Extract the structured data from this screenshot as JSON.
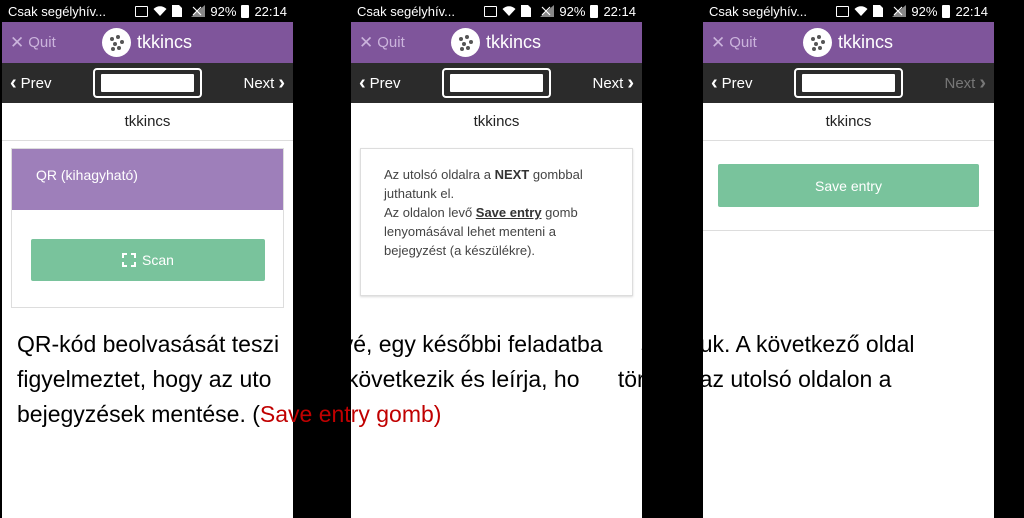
{
  "status_bar": {
    "carrier": "Csak segélyhív...",
    "battery": "92%",
    "time": "22:14"
  },
  "app_bar": {
    "quit_label": "Quit",
    "brand_name": "tkkincs"
  },
  "nav": {
    "prev_label": "Prev",
    "next_label": "Next"
  },
  "page_title": "tkkincs",
  "screen1": {
    "qr_header": "QR (kihagyható)",
    "scan_label": "Scan"
  },
  "screen2": {
    "line1_pre": "Az utolsó oldalra a ",
    "line1_bold": "NEXT",
    "line1_post": " gombbal",
    "line2": "juthatunk el.",
    "line3_pre": "Az oldalon levő ",
    "line3_link": "Save entry",
    "line3_post": " gomb",
    "line4": "lenyomásával lehet menteni a",
    "line5": "bejegyzést (a készülékre)."
  },
  "screen3": {
    "save_label": "Save entry",
    "next_disabled": true
  },
  "caption": {
    "line1": "QR-kód beolvasását teszi      zővé, egy későbbi feladatba      sználjuk. A következő oldal",
    "line2": "figyelmeztet, hogy az uto      dal következik és leírja, ho      történik az utolsó oldalon a",
    "line3_pre": "bejegyzések mentése. (",
    "line3_red": "Save entry gomb)"
  },
  "colors": {
    "app_bar": "#7f559b",
    "nav_bar": "#2b2b2b",
    "accent_green": "#79c39c",
    "qr_header": "#9e7fba",
    "caption_red": "#c00000"
  }
}
